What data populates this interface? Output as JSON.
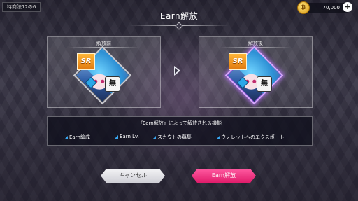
{
  "header": {
    "tag": "特商法12の6",
    "title": "Earn解放"
  },
  "currency": {
    "coin_symbol": "₿",
    "value": "70,000",
    "plus": "+"
  },
  "panels": {
    "before_label": "解放前",
    "after_label": "解放後",
    "rarity": "SR",
    "attribute": "無"
  },
  "features": {
    "title": "『Earn解放』によって解放される機能",
    "items": [
      "Earn編成",
      "Earn Lv.",
      "スカウトの募集",
      "ウォレットへのエクスポート"
    ]
  },
  "buttons": {
    "cancel": "キャンセル",
    "earn": "Earn解放"
  },
  "colors": {
    "accent": "#e01c6b",
    "rarity_gold": "#e07a10",
    "feature_mark": "#38a5f0"
  }
}
